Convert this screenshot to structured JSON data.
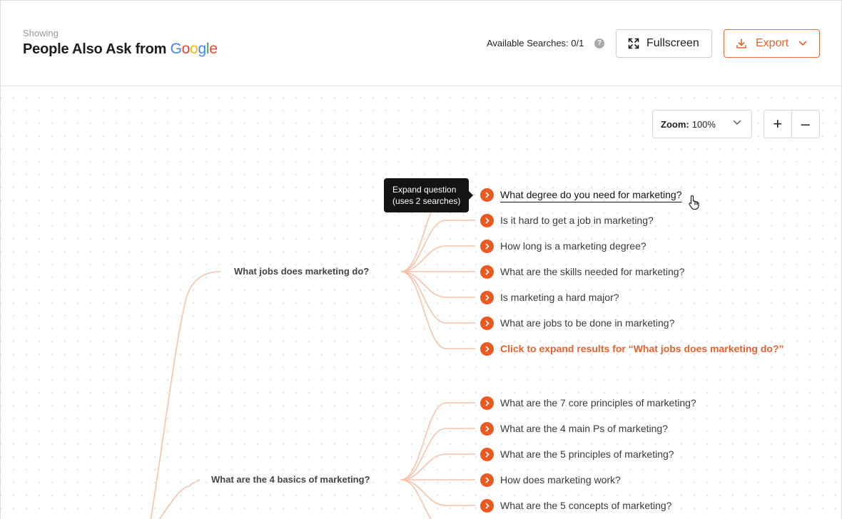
{
  "header": {
    "showing_label": "Showing",
    "title_prefix": "People Also Ask from",
    "google": [
      "G",
      "o",
      "o",
      "g",
      "l",
      "e"
    ],
    "available_searches": "Available Searches: 0/1",
    "help_icon_glyph": "?",
    "fullscreen_label": "Fullscreen",
    "export_label": "Export"
  },
  "toolbar": {
    "zoom_label": "Zoom:",
    "zoom_value": "100%",
    "zoom_in_glyph": "+",
    "zoom_out_glyph": "–"
  },
  "tooltip": {
    "line1": "Expand question",
    "line2": "(uses 2 searches)"
  },
  "groups": [
    {
      "question": "What jobs does marketing do?",
      "children": [
        "What degree do you need for marketing?",
        "Is it hard to get a job in marketing?",
        "How long is a marketing degree?",
        "What are the skills needed for marketing?",
        "Is marketing a hard major?",
        "What are jobs to be done in marketing?"
      ],
      "expand_link": "Click to expand results for “What jobs does marketing do?”"
    },
    {
      "question": "What are the 4 basics of marketing?",
      "children": [
        "What are the 7 core principles of marketing?",
        "What are the 4 main Ps of marketing?",
        "What are the 5 principles of marketing?",
        "How does marketing work?",
        "What are the 5 concepts of marketing?"
      ]
    }
  ],
  "colors": {
    "accent": "#ea5a1f",
    "link_line": "#f6c3ac",
    "google_blue": "#4285F4",
    "google_red": "#EA4335",
    "google_yellow": "#FBBC05",
    "google_green": "#34A853"
  },
  "icons": {
    "fullscreen": "expand-arrows-icon",
    "export": "download-icon",
    "dropdown": "chevron-down-icon",
    "node": "chevron-right-circle-icon",
    "cursor": "hand-pointer-icon"
  }
}
